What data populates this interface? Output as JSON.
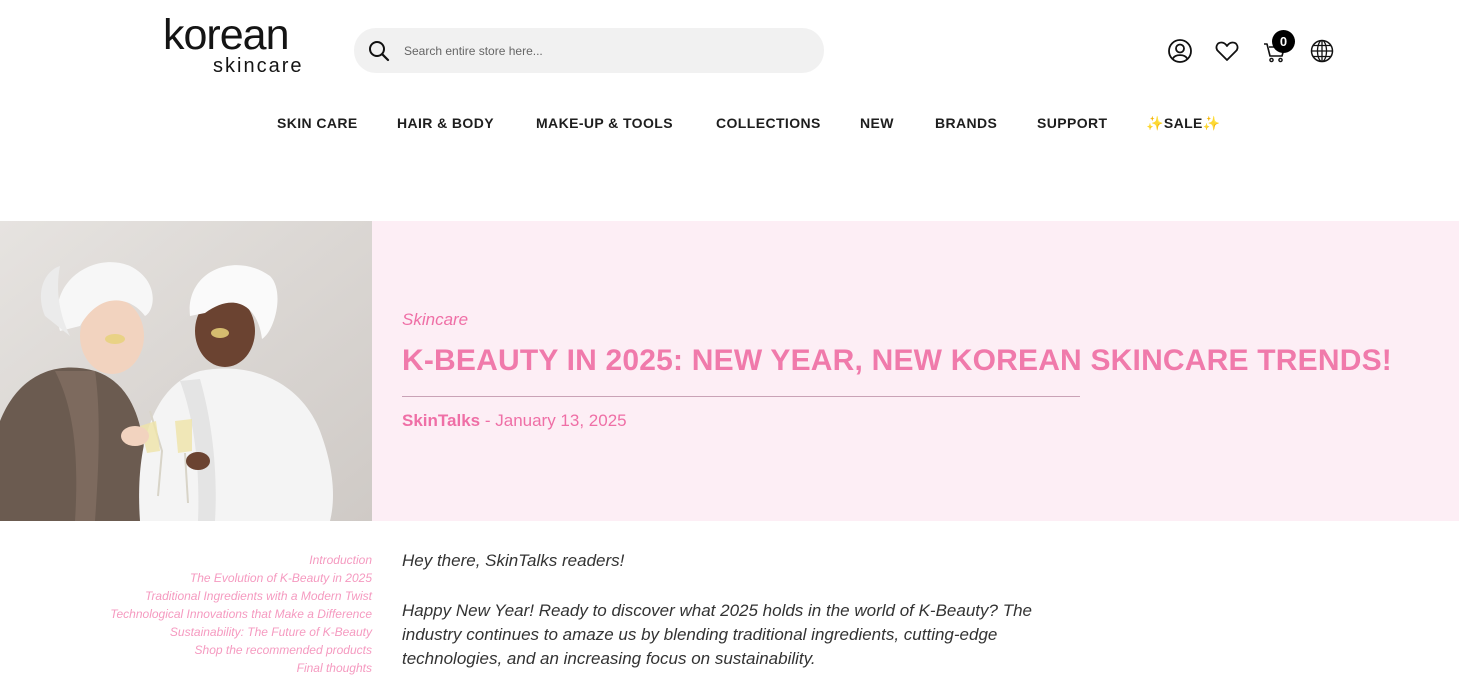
{
  "header": {
    "logo_main": "korean",
    "logo_sub": "skincare",
    "search_placeholder": "Search entire store here...",
    "cart_count": "0",
    "icons": [
      "search-icon",
      "account-icon",
      "heart-icon",
      "cart-icon",
      "globe-icon"
    ]
  },
  "nav": {
    "items": [
      "SKIN CARE",
      "HAIR & BODY",
      "MAKE-UP & TOOLS",
      "COLLECTIONS",
      "NEW",
      "BRANDS",
      "SUPPORT",
      "✨SALE✨"
    ]
  },
  "article": {
    "category": "Skincare",
    "title": "K-BEAUTY IN 2025: NEW YEAR, NEW KOREAN SKINCARE TRENDS!",
    "author": "SkinTalks",
    "date_separator": " - ",
    "date": "January 13, 2025",
    "greeting": "Hey there, SkinTalks readers!",
    "intro": "Happy New Year! Ready to discover what 2025 holds in the world of K-Beauty? The industry continues to amaze us by blending traditional ingredients, cutting-edge technologies, and an increasing focus on sustainability."
  },
  "toc": {
    "items": [
      "Introduction",
      "The Evolution of K-Beauty in 2025",
      "Traditional Ingredients with a Modern Twist",
      "Technological Innovations that Make a Difference",
      "Sustainability: The Future of K-Beauty",
      "Shop the recommended products",
      "Final thoughts"
    ]
  },
  "colors": {
    "accent_pink": "#f07aab",
    "hero_bg": "#fdeef5",
    "search_bg": "#f1f1f1"
  }
}
